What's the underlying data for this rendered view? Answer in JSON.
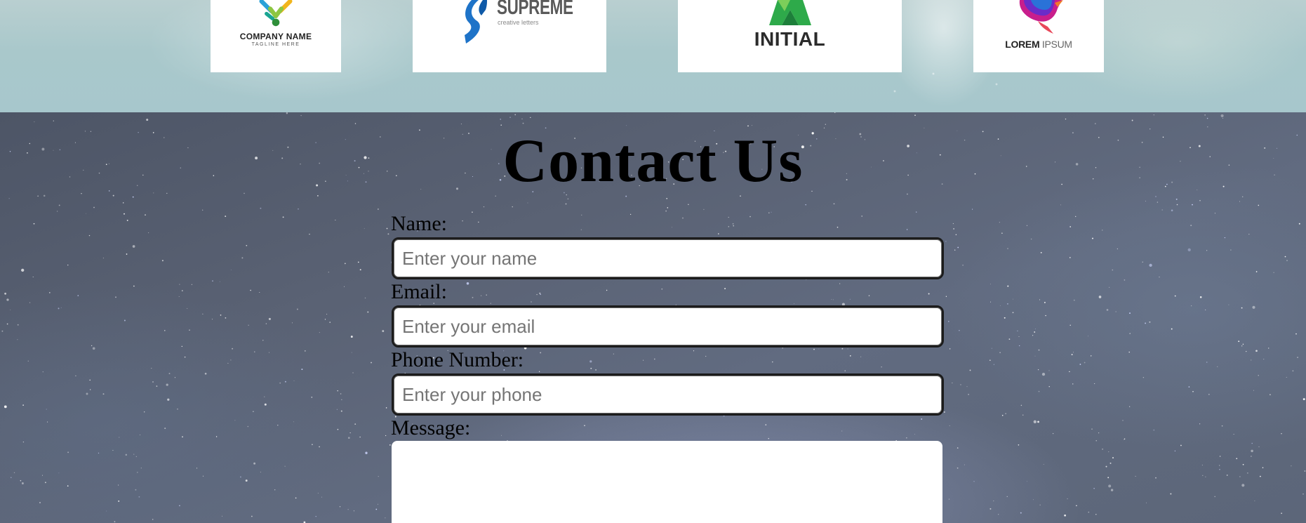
{
  "logos": [
    {
      "name": "COMPANY NAME",
      "tagline": "TAGLINE HERE"
    },
    {
      "name": "SUPREME",
      "tagline": "creative letters"
    },
    {
      "name": "INITIAL"
    },
    {
      "name": "LOREM",
      "name2": "IPSUM"
    }
  ],
  "contact": {
    "title": "Contact Us",
    "fields": {
      "name": {
        "label": "Name:",
        "placeholder": "Enter your name",
        "value": ""
      },
      "email": {
        "label": "Email:",
        "placeholder": "Enter your email",
        "value": ""
      },
      "phone": {
        "label": "Phone Number:",
        "placeholder": "Enter your phone",
        "value": ""
      },
      "message": {
        "label": "Message:",
        "value": ""
      }
    }
  },
  "colors": {
    "logo_strip_bg": "#a9c8cb",
    "contact_bg": "#5a6274",
    "supreme_blue": "#1e73c8",
    "initial_green": "#2eaa4a",
    "lorem_magenta": "#c81e8c"
  },
  "icons": [
    "company-logo-icon",
    "supreme-logo-icon",
    "initial-logo-icon",
    "lorem-ipsum-logo-icon"
  ]
}
